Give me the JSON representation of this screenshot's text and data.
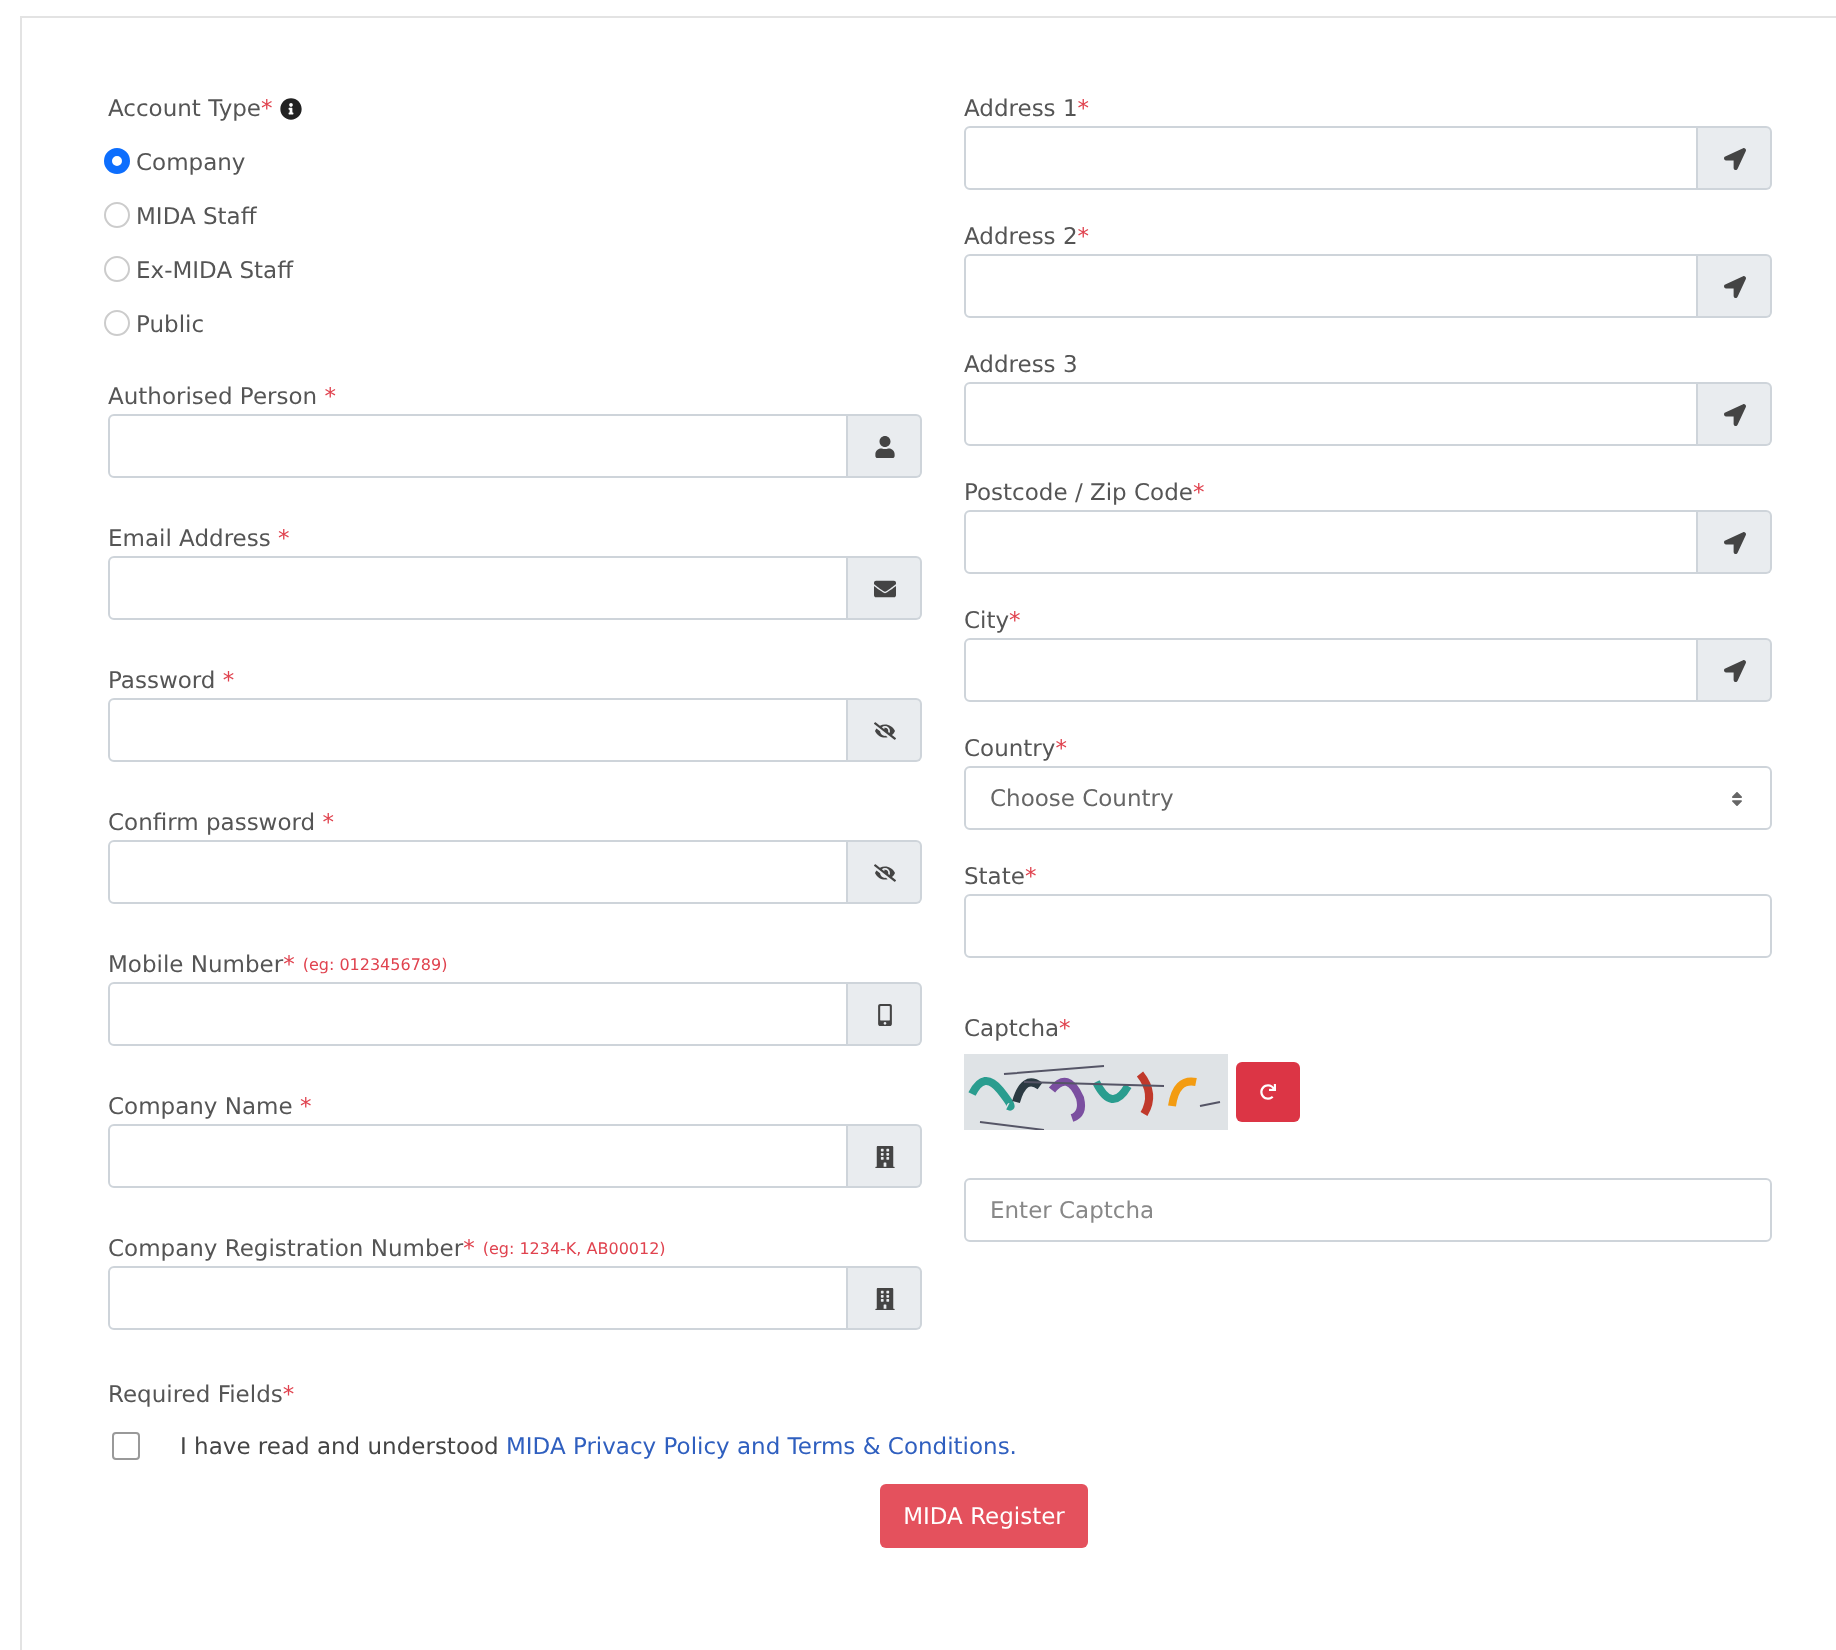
{
  "account_type": {
    "label": "Account Type",
    "mark": "*",
    "options": [
      {
        "label": "Company",
        "selected": true
      },
      {
        "label": "MIDA Staff",
        "selected": false
      },
      {
        "label": "Ex-MIDA Staff",
        "selected": false
      },
      {
        "label": "Public",
        "selected": false
      }
    ]
  },
  "left_fields": [
    {
      "label": "Authorised Person",
      "mark": " *",
      "kind": "user"
    },
    {
      "label": "Email Address",
      "mark": " *",
      "kind": "envelope"
    },
    {
      "label": "Password",
      "mark": " *",
      "kind": "password"
    },
    {
      "label": "Confirm password",
      "mark": " *",
      "kind": "password"
    },
    {
      "label": "Mobile Number",
      "mark": "*",
      "hint": "(eg: 0123456789)",
      "kind": "mobile"
    },
    {
      "label": "Company Name",
      "mark": " *",
      "kind": "building"
    },
    {
      "label": "Company Registration Number",
      "mark": "*",
      "hint": "(eg: 1234-K, AB00012)",
      "kind": "building"
    }
  ],
  "right_fields": [
    {
      "kind": "addon",
      "label": "Address 1",
      "mark": "*"
    },
    {
      "kind": "addon",
      "label": "Address 2",
      "mark": "*"
    },
    {
      "kind": "addon",
      "label": "Address 3"
    },
    {
      "kind": "addon",
      "label": "Postcode / Zip Code",
      "mark": "*"
    },
    {
      "kind": "addon",
      "label": "City",
      "mark": "*"
    },
    {
      "kind": "select",
      "label": "Country",
      "mark": "*",
      "value": "Choose Country"
    },
    {
      "kind": "plain",
      "label": "State",
      "mark": "*"
    },
    {
      "kind": "captcha",
      "label": "Captcha",
      "mark": "*",
      "placeholder": "Enter Captcha"
    }
  ],
  "required_note": {
    "label": "Required Fields",
    "mark": "*"
  },
  "agreement": {
    "checked": false,
    "text": "I have read and understood ",
    "link": "MIDA Privacy Policy and Terms & Conditions."
  },
  "submit": "MIDA Register"
}
